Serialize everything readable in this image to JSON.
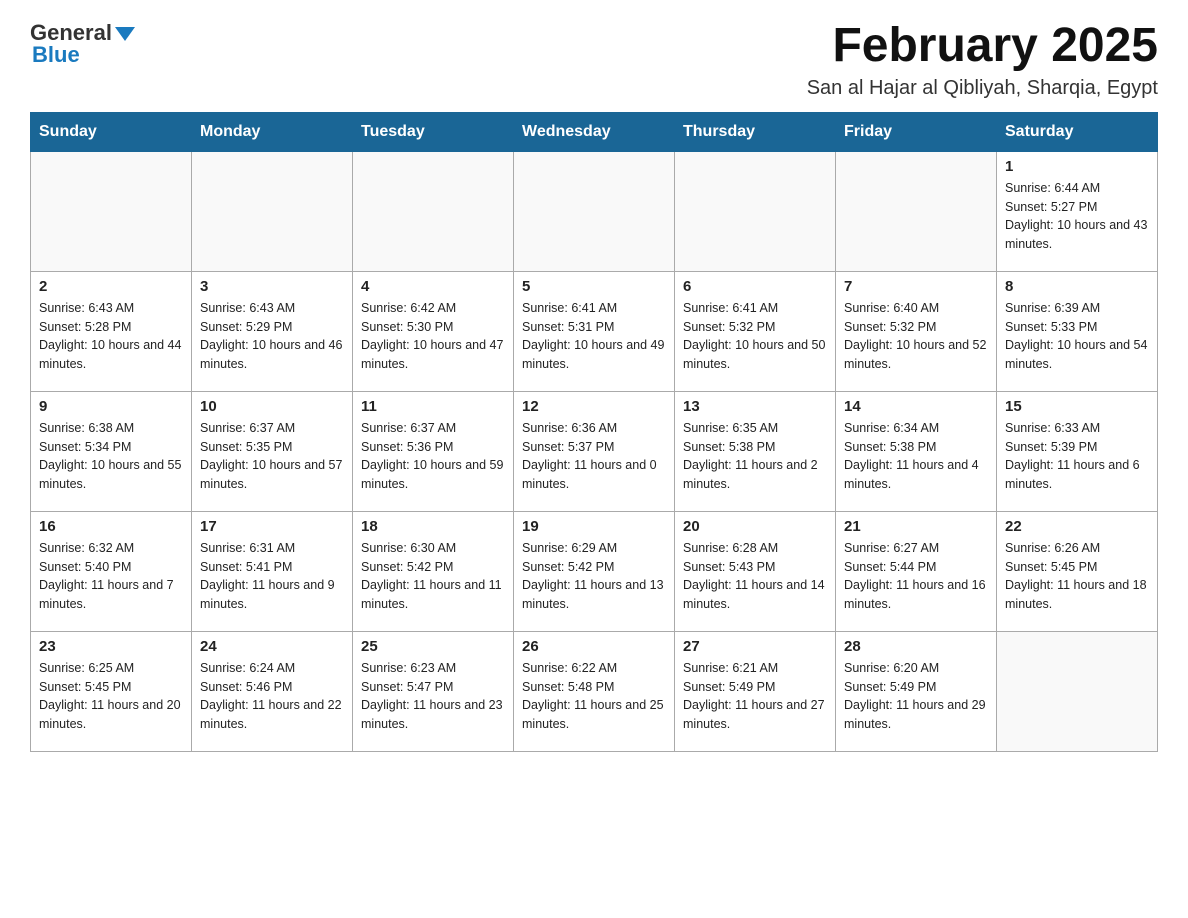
{
  "logo": {
    "general": "General",
    "blue": "Blue"
  },
  "title": "February 2025",
  "subtitle": "San al Hajar al Qibliyah, Sharqia, Egypt",
  "days_of_week": [
    "Sunday",
    "Monday",
    "Tuesday",
    "Wednesday",
    "Thursday",
    "Friday",
    "Saturday"
  ],
  "weeks": [
    [
      {
        "day": "",
        "info": ""
      },
      {
        "day": "",
        "info": ""
      },
      {
        "day": "",
        "info": ""
      },
      {
        "day": "",
        "info": ""
      },
      {
        "day": "",
        "info": ""
      },
      {
        "day": "",
        "info": ""
      },
      {
        "day": "1",
        "info": "Sunrise: 6:44 AM\nSunset: 5:27 PM\nDaylight: 10 hours and 43 minutes."
      }
    ],
    [
      {
        "day": "2",
        "info": "Sunrise: 6:43 AM\nSunset: 5:28 PM\nDaylight: 10 hours and 44 minutes."
      },
      {
        "day": "3",
        "info": "Sunrise: 6:43 AM\nSunset: 5:29 PM\nDaylight: 10 hours and 46 minutes."
      },
      {
        "day": "4",
        "info": "Sunrise: 6:42 AM\nSunset: 5:30 PM\nDaylight: 10 hours and 47 minutes."
      },
      {
        "day": "5",
        "info": "Sunrise: 6:41 AM\nSunset: 5:31 PM\nDaylight: 10 hours and 49 minutes."
      },
      {
        "day": "6",
        "info": "Sunrise: 6:41 AM\nSunset: 5:32 PM\nDaylight: 10 hours and 50 minutes."
      },
      {
        "day": "7",
        "info": "Sunrise: 6:40 AM\nSunset: 5:32 PM\nDaylight: 10 hours and 52 minutes."
      },
      {
        "day": "8",
        "info": "Sunrise: 6:39 AM\nSunset: 5:33 PM\nDaylight: 10 hours and 54 minutes."
      }
    ],
    [
      {
        "day": "9",
        "info": "Sunrise: 6:38 AM\nSunset: 5:34 PM\nDaylight: 10 hours and 55 minutes."
      },
      {
        "day": "10",
        "info": "Sunrise: 6:37 AM\nSunset: 5:35 PM\nDaylight: 10 hours and 57 minutes."
      },
      {
        "day": "11",
        "info": "Sunrise: 6:37 AM\nSunset: 5:36 PM\nDaylight: 10 hours and 59 minutes."
      },
      {
        "day": "12",
        "info": "Sunrise: 6:36 AM\nSunset: 5:37 PM\nDaylight: 11 hours and 0 minutes."
      },
      {
        "day": "13",
        "info": "Sunrise: 6:35 AM\nSunset: 5:38 PM\nDaylight: 11 hours and 2 minutes."
      },
      {
        "day": "14",
        "info": "Sunrise: 6:34 AM\nSunset: 5:38 PM\nDaylight: 11 hours and 4 minutes."
      },
      {
        "day": "15",
        "info": "Sunrise: 6:33 AM\nSunset: 5:39 PM\nDaylight: 11 hours and 6 minutes."
      }
    ],
    [
      {
        "day": "16",
        "info": "Sunrise: 6:32 AM\nSunset: 5:40 PM\nDaylight: 11 hours and 7 minutes."
      },
      {
        "day": "17",
        "info": "Sunrise: 6:31 AM\nSunset: 5:41 PM\nDaylight: 11 hours and 9 minutes."
      },
      {
        "day": "18",
        "info": "Sunrise: 6:30 AM\nSunset: 5:42 PM\nDaylight: 11 hours and 11 minutes."
      },
      {
        "day": "19",
        "info": "Sunrise: 6:29 AM\nSunset: 5:42 PM\nDaylight: 11 hours and 13 minutes."
      },
      {
        "day": "20",
        "info": "Sunrise: 6:28 AM\nSunset: 5:43 PM\nDaylight: 11 hours and 14 minutes."
      },
      {
        "day": "21",
        "info": "Sunrise: 6:27 AM\nSunset: 5:44 PM\nDaylight: 11 hours and 16 minutes."
      },
      {
        "day": "22",
        "info": "Sunrise: 6:26 AM\nSunset: 5:45 PM\nDaylight: 11 hours and 18 minutes."
      }
    ],
    [
      {
        "day": "23",
        "info": "Sunrise: 6:25 AM\nSunset: 5:45 PM\nDaylight: 11 hours and 20 minutes."
      },
      {
        "day": "24",
        "info": "Sunrise: 6:24 AM\nSunset: 5:46 PM\nDaylight: 11 hours and 22 minutes."
      },
      {
        "day": "25",
        "info": "Sunrise: 6:23 AM\nSunset: 5:47 PM\nDaylight: 11 hours and 23 minutes."
      },
      {
        "day": "26",
        "info": "Sunrise: 6:22 AM\nSunset: 5:48 PM\nDaylight: 11 hours and 25 minutes."
      },
      {
        "day": "27",
        "info": "Sunrise: 6:21 AM\nSunset: 5:49 PM\nDaylight: 11 hours and 27 minutes."
      },
      {
        "day": "28",
        "info": "Sunrise: 6:20 AM\nSunset: 5:49 PM\nDaylight: 11 hours and 29 minutes."
      },
      {
        "day": "",
        "info": ""
      }
    ]
  ]
}
